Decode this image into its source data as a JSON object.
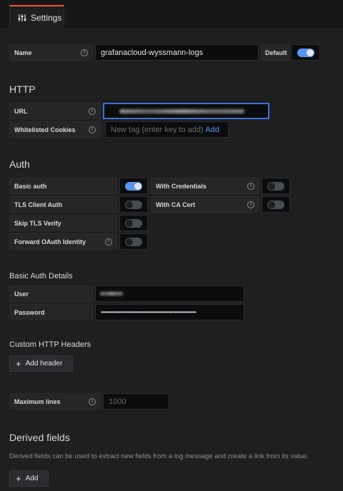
{
  "tab": {
    "label": "Settings",
    "icon": "sliders-icon",
    "accent": "#f05a28"
  },
  "name": {
    "label": "Name",
    "value": "grafanacloud-wyssmann-logs",
    "default_label": "Default",
    "default_on": true
  },
  "http": {
    "heading": "HTTP",
    "url_label": "URL",
    "url_value": "",
    "cookies_label": "Whitelisted Cookies",
    "cookies_placeholder": "New tag (enter key to add)",
    "add_label": "Add"
  },
  "auth": {
    "heading": "Auth",
    "basic_auth": {
      "label": "Basic auth",
      "on": true
    },
    "with_credentials": {
      "label": "With Credentials",
      "on": false
    },
    "tls_client_auth": {
      "label": "TLS Client Auth",
      "on": false
    },
    "with_ca_cert": {
      "label": "With CA Cert",
      "on": false
    },
    "skip_tls_verify": {
      "label": "Skip TLS Verify",
      "on": false
    },
    "forward_oauth": {
      "label": "Forward OAuth Identity",
      "on": false
    }
  },
  "basic_auth_details": {
    "heading": "Basic Auth Details",
    "user_label": "User",
    "password_label": "Password",
    "password_mask": "••••••••••••••••••••••••••••••••••••••••••••••••••••••••••"
  },
  "custom_headers": {
    "heading": "Custom HTTP Headers",
    "add_label": "Add header"
  },
  "max_lines": {
    "label": "Maximum lines",
    "placeholder": "1000"
  },
  "derived": {
    "heading": "Derived fields",
    "description": "Derived fields can be used to extract new fields from a log message and create a link from its value.",
    "add_label": "Add"
  },
  "colors": {
    "accent": "#5794f2",
    "focus": "#3d71d9"
  }
}
